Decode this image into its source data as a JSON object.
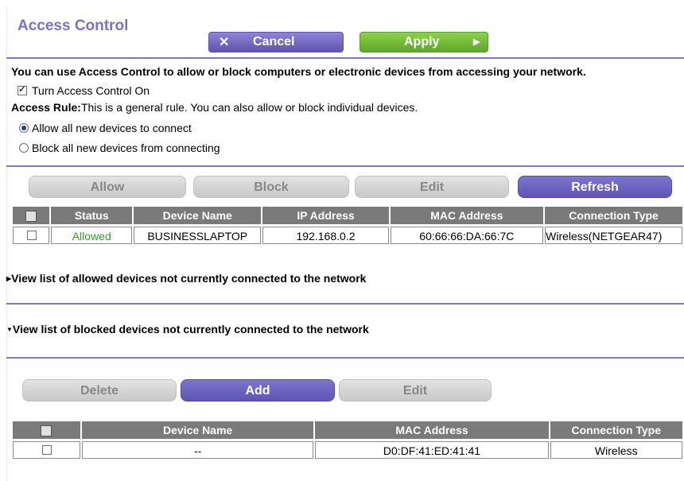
{
  "header": {
    "title": "Access Control",
    "cancel_label": "Cancel",
    "apply_label": "Apply"
  },
  "intro": {
    "description": "You can use Access Control to allow or block computers or electronic devices from accessing your network.",
    "turn_on_label": "Turn Access Control On",
    "turn_on_checked": true,
    "rule_label": "Access Rule:",
    "rule_text": "This is a general rule. You can also allow or block individual devices.",
    "options": [
      {
        "label": "Allow all new devices to connect",
        "selected": true
      },
      {
        "label": "Block all new devices from connecting",
        "selected": false
      }
    ]
  },
  "device_toolbar": {
    "allow_label": "Allow",
    "block_label": "Block",
    "edit_label": "Edit",
    "refresh_label": "Refresh"
  },
  "device_table": {
    "headers": [
      "Status",
      "Device Name",
      "IP Address",
      "MAC Address",
      "Connection Type"
    ],
    "rows": [
      {
        "status": "Allowed",
        "device_name": "BUSINESSLAPTOP",
        "ip": "192.168.0.2",
        "mac": "60:66:66:DA:66:7C",
        "connection": "Wireless(NETGEAR47)"
      }
    ]
  },
  "expanders": {
    "allowed_list": "View list of allowed devices not currently connected to the network",
    "blocked_list": "View list of blocked devices not currently connected to the network"
  },
  "blocked_toolbar": {
    "delete_label": "Delete",
    "add_label": "Add",
    "edit_label": "Edit"
  },
  "blocked_table": {
    "headers": [
      "Device Name",
      "MAC Address",
      "Connection Type"
    ],
    "rows": [
      {
        "device_name": "--",
        "mac": "D0:DF:41:ED:41:41",
        "connection": "Wireless"
      }
    ]
  },
  "colors": {
    "accent_purple": "#7d72c4",
    "apply_green": "#6cb533",
    "header_gray": "#7a7a7a",
    "allowed_green": "#3b9a2f"
  }
}
